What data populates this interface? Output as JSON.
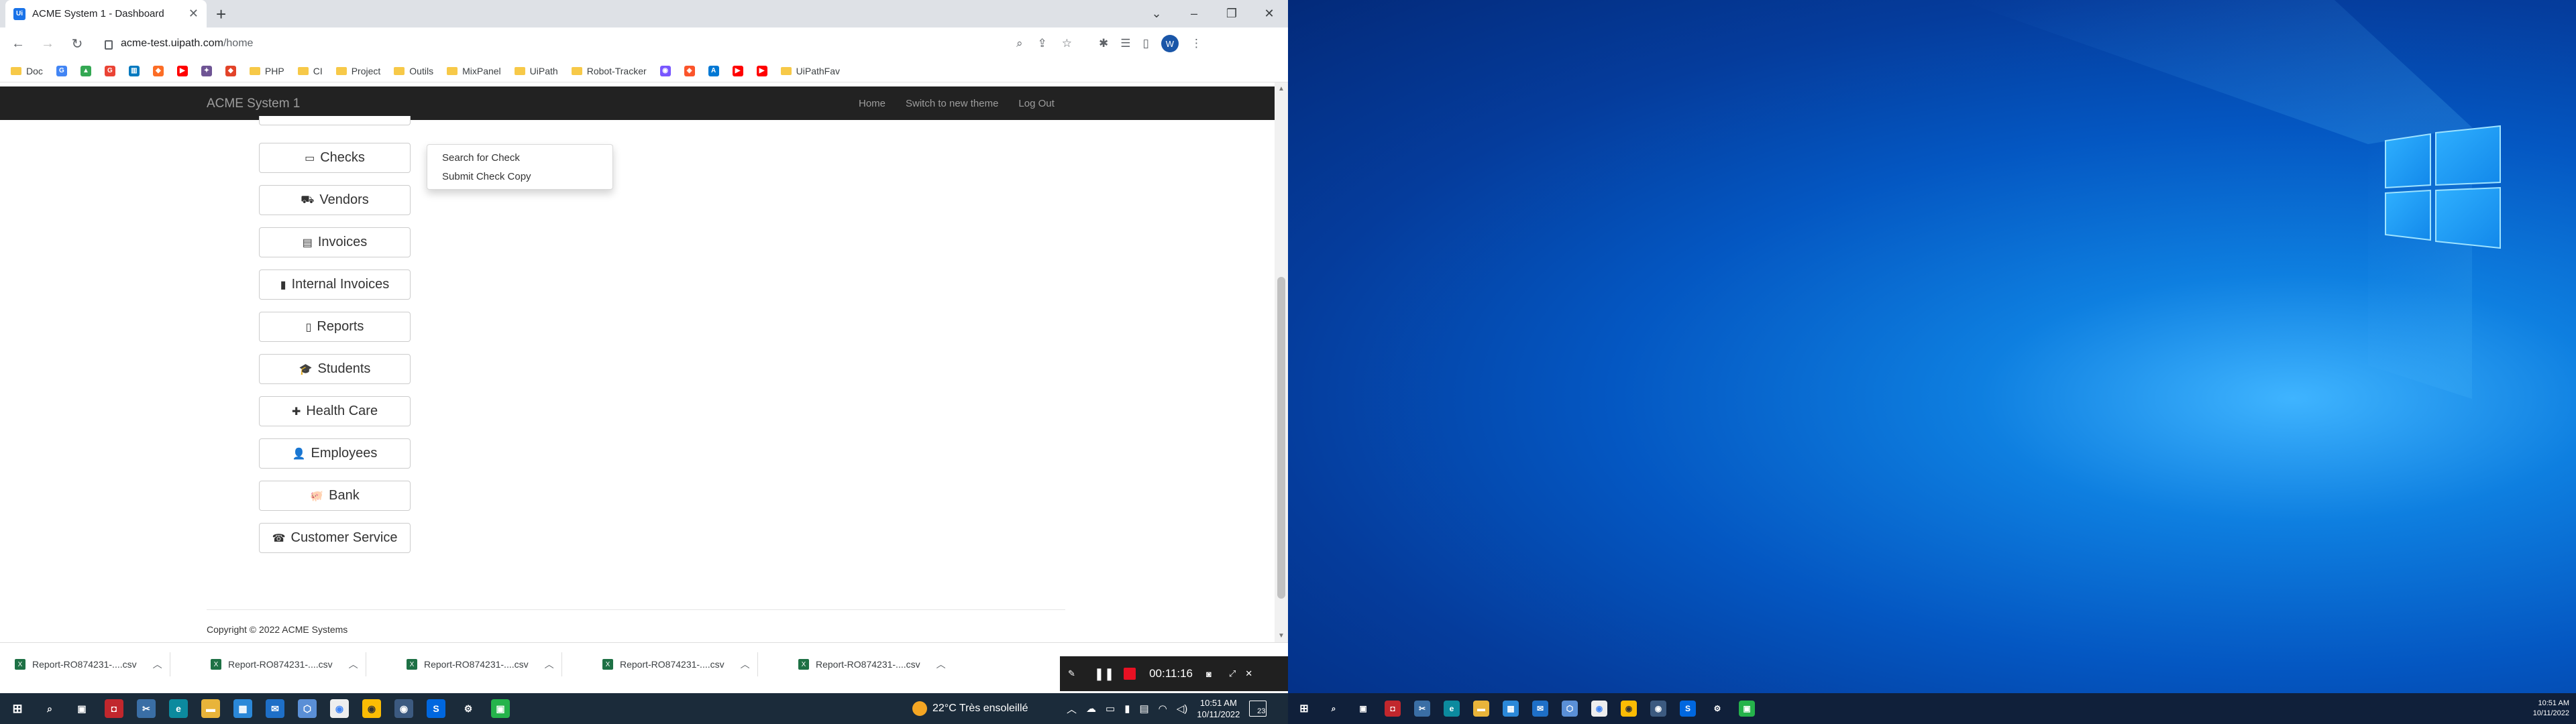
{
  "browser": {
    "tab_title": "ACME System 1 - Dashboard",
    "url_host": "acme-test.uipath.com",
    "url_path": "/home",
    "profile_initial": "W",
    "bookmarks": [
      "Doc",
      "PHP",
      "CI",
      "Project",
      "Outils",
      "MixPanel",
      "UiPath",
      "Robot-Tracker",
      "UiPathFav"
    ]
  },
  "app": {
    "brand": "ACME System 1",
    "nav": [
      "Home",
      "Switch to new theme",
      "Log Out"
    ],
    "menu": [
      {
        "label": "Checks",
        "icon": "▭"
      },
      {
        "label": "Vendors",
        "icon": "⛟"
      },
      {
        "label": "Invoices",
        "icon": "▤"
      },
      {
        "label": "Internal Invoices",
        "icon": "▮"
      },
      {
        "label": "Reports",
        "icon": "▯"
      },
      {
        "label": "Students",
        "icon": "🎓"
      },
      {
        "label": "Health Care",
        "icon": "✚"
      },
      {
        "label": "Employees",
        "icon": "👤"
      },
      {
        "label": "Bank",
        "icon": "🐖"
      },
      {
        "label": "Customer Service",
        "icon": "☎"
      }
    ],
    "dropdown": [
      "Search for Check",
      "Submit Check Copy"
    ],
    "copyright": "Copyright © 2022 ACME Systems"
  },
  "downloads": [
    "Report-RO874231-....csv",
    "Report-RO874231-....csv",
    "Report-RO874231-....csv",
    "Report-RO874231-....csv",
    "Report-RO874231-....csv"
  ],
  "recorder": {
    "time": "00:11:16"
  },
  "taskbar1": {
    "weather": "22°C  Très ensoleillé",
    "time": "10:51 AM",
    "date": "10/11/2022",
    "notifications": "23"
  },
  "taskbar2": {
    "time": "10:51 AM",
    "date": "10/11/2022"
  }
}
